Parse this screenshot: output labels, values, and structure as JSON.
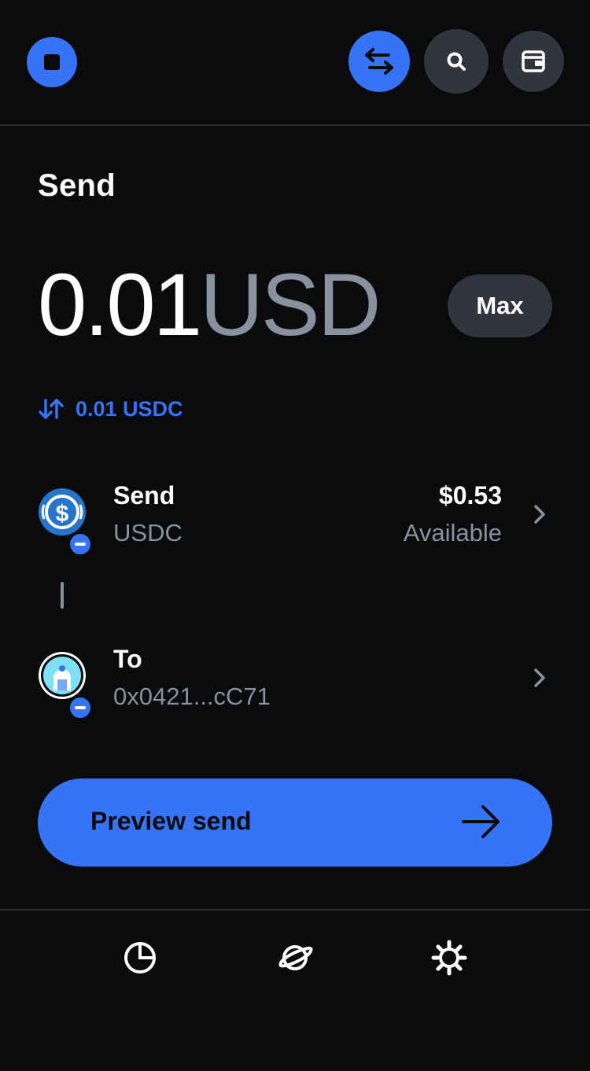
{
  "header": {
    "logo_icon": "coinbase-square-icon",
    "swap_icon": "swap-arrows-icon",
    "search_icon": "search-icon",
    "wallet_icon": "wallet-icon"
  },
  "page": {
    "title": "Send"
  },
  "amount": {
    "value": "0.01",
    "currency": "USD",
    "max_label": "Max",
    "converted": "0.01 USDC"
  },
  "send_row": {
    "title": "Send",
    "asset": "USDC",
    "balance": "$0.53",
    "balance_label": "Available"
  },
  "to_row": {
    "title": "To",
    "address": "0x0421...cC71"
  },
  "primary_action": {
    "label": "Preview send"
  },
  "nav": {
    "items": [
      "portfolio-icon",
      "explore-icon",
      "settings-icon"
    ]
  },
  "colors": {
    "background": "#0a0b0d",
    "accent": "#3773f5",
    "muted": "#8a919e",
    "surface": "#32353d"
  }
}
